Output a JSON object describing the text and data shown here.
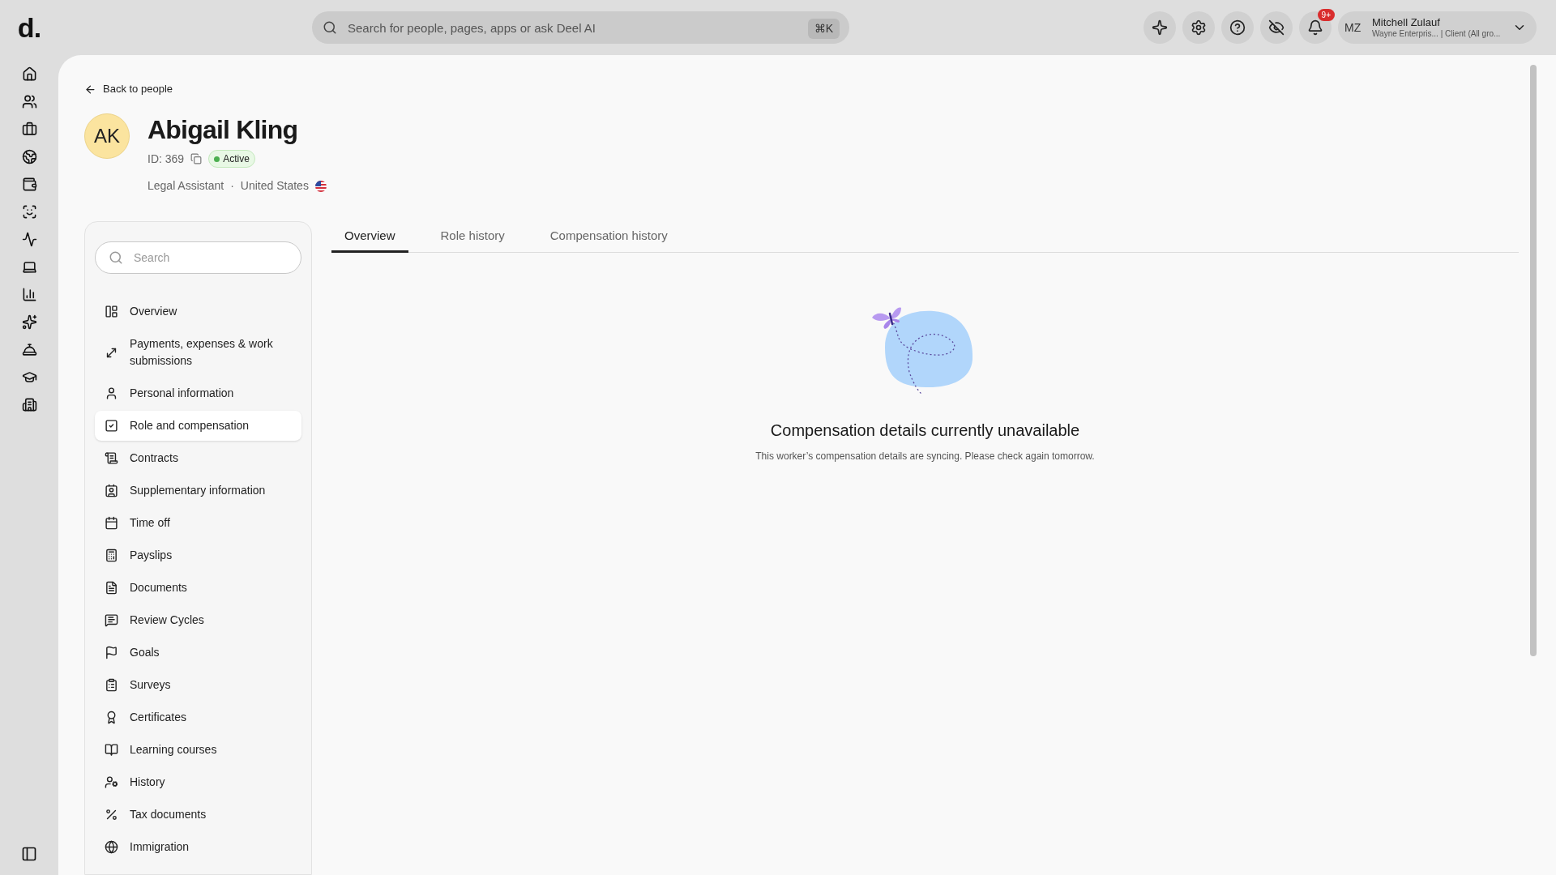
{
  "topbar": {
    "logo": "d.",
    "search": {
      "placeholder": "Search for people, pages, apps or ask Deel AI",
      "shortcut": "⌘K"
    },
    "notification_badge": "9+",
    "user": {
      "initials": "MZ",
      "name": "Mitchell Zulauf",
      "subtitle": "Wayne Enterpris... | Client (All gro..."
    }
  },
  "profile": {
    "back_link": "Back to people",
    "initials": "AK",
    "name": "Abigail Kling",
    "id": "ID: 369",
    "status": "Active",
    "role": "Legal Assistant",
    "separator": "·",
    "country": "United States"
  },
  "nav": {
    "search": {
      "placeholder": "Search"
    },
    "items": [
      {
        "label": "Overview",
        "selected": false
      },
      {
        "label": "Payments, expenses & work submissions",
        "selected": false
      },
      {
        "label": "Personal information",
        "selected": false
      },
      {
        "label": "Role and compensation",
        "selected": true
      },
      {
        "label": "Contracts",
        "selected": false
      },
      {
        "label": "Supplementary information",
        "selected": false
      },
      {
        "label": "Time off",
        "selected": false
      },
      {
        "label": "Payslips",
        "selected": false
      },
      {
        "label": "Documents",
        "selected": false
      },
      {
        "label": "Review Cycles",
        "selected": false
      },
      {
        "label": "Goals",
        "selected": false
      },
      {
        "label": "Surveys",
        "selected": false
      },
      {
        "label": "Certificates",
        "selected": false
      },
      {
        "label": "Learning courses",
        "selected": false
      },
      {
        "label": "History",
        "selected": false
      },
      {
        "label": "Tax documents",
        "selected": false
      },
      {
        "label": "Immigration",
        "selected": false
      }
    ]
  },
  "tabs": [
    {
      "label": "Overview",
      "selected": true
    },
    {
      "label": "Role history",
      "selected": false
    },
    {
      "label": "Compensation history",
      "selected": false
    }
  ],
  "empty_state": {
    "title": "Compensation details currently unavailable",
    "message": "This worker’s compensation details are syncing. Please check again tomorrow."
  }
}
